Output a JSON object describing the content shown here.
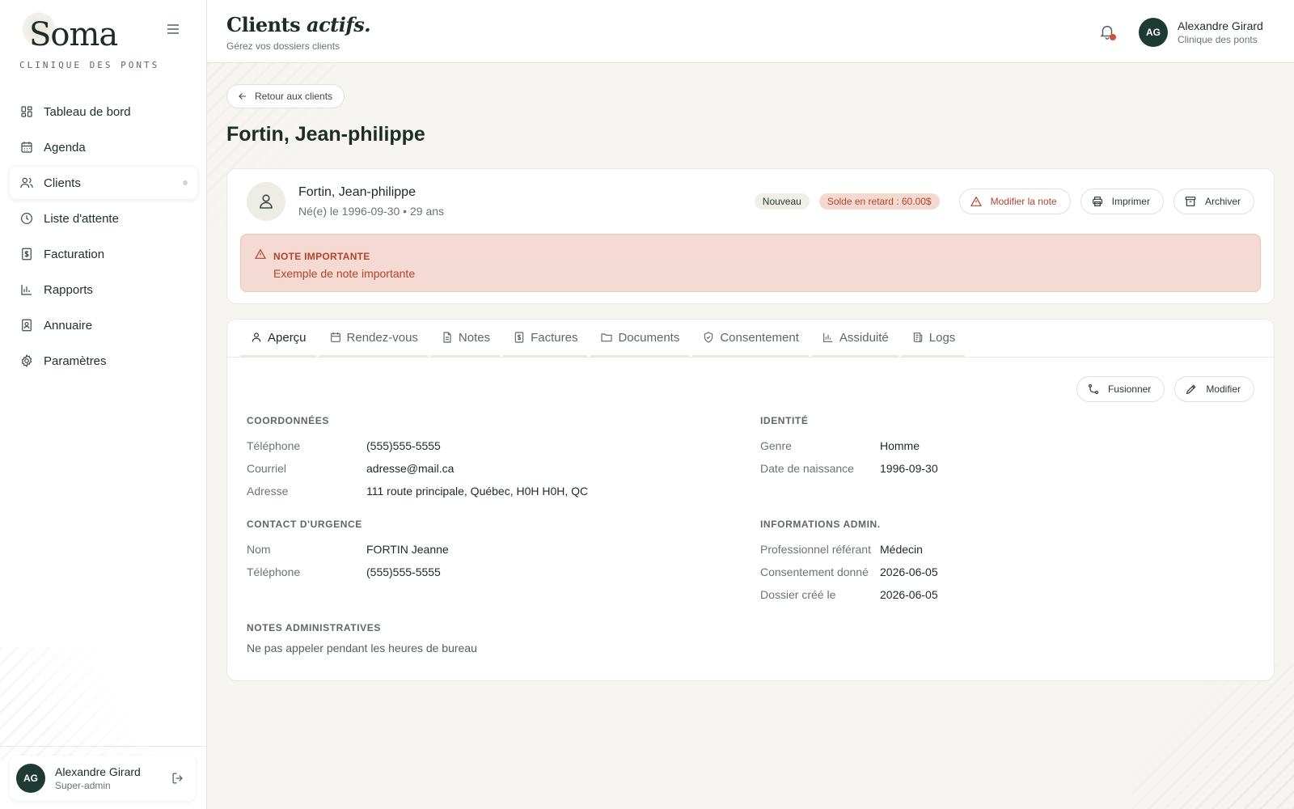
{
  "brand": {
    "name": "Soma",
    "subtitle": "CLINIQUE DES PONTS"
  },
  "nav": [
    {
      "label": "Tableau de bord",
      "icon": "dashboard-icon"
    },
    {
      "label": "Agenda",
      "icon": "calendar-icon"
    },
    {
      "label": "Clients",
      "icon": "users-icon",
      "active": true
    },
    {
      "label": "Liste d'attente",
      "icon": "clock-icon"
    },
    {
      "label": "Facturation",
      "icon": "invoice-icon"
    },
    {
      "label": "Rapports",
      "icon": "bar-chart-icon"
    },
    {
      "label": "Annuaire",
      "icon": "contact-book-icon"
    },
    {
      "label": "Paramètres",
      "icon": "gear-icon"
    }
  ],
  "sidebar_user": {
    "initials": "AG",
    "name": "Alexandre Girard",
    "role": "Super-admin"
  },
  "header": {
    "title": "Clients",
    "title_em": "actifs.",
    "subtitle": "Gérez vos dossiers clients",
    "user": {
      "initials": "AG",
      "name": "Alexandre Girard",
      "clinic": "Clinique des ponts"
    }
  },
  "back_label": "Retour aux clients",
  "client": {
    "heading": "Fortin, Jean-philippe",
    "name": "Fortin, Jean-philippe",
    "dob_line": "Né(e) le 1996-09-30 • 29 ans",
    "badge_new": "Nouveau",
    "badge_late": "Solde en retard : 60.00$",
    "actions": {
      "edit_note": "Modifier la note",
      "print": "Imprimer",
      "archive": "Archiver"
    },
    "important_note": {
      "title": "NOTE IMPORTANTE",
      "body": "Exemple de note importante"
    }
  },
  "tabs": [
    {
      "label": "Aperçu",
      "icon": "user-icon",
      "active": true
    },
    {
      "label": "Rendez-vous",
      "icon": "calendar-icon"
    },
    {
      "label": "Notes",
      "icon": "document-icon"
    },
    {
      "label": "Factures",
      "icon": "invoice-icon"
    },
    {
      "label": "Documents",
      "icon": "folder-icon"
    },
    {
      "label": "Consentement",
      "icon": "shield-check-icon"
    },
    {
      "label": "Assiduité",
      "icon": "bar-chart-icon"
    },
    {
      "label": "Logs",
      "icon": "log-scroll-icon"
    }
  ],
  "body_actions": {
    "merge": "Fusionner",
    "edit": "Modifier"
  },
  "coordonnees": {
    "title": "COORDONNÉES",
    "rows": [
      {
        "k": "Téléphone",
        "v": "(555)555-5555"
      },
      {
        "k": "Courriel",
        "v": "adresse@mail.ca"
      },
      {
        "k": "Adresse",
        "v": "111 route principale, Québec, H0H H0H, QC"
      }
    ]
  },
  "identite": {
    "title": "IDENTITÉ",
    "rows": [
      {
        "k": "Genre",
        "v": "Homme"
      },
      {
        "k": "Date de naissance",
        "v": "1996-09-30"
      }
    ]
  },
  "urgence": {
    "title": "CONTACT D'URGENCE",
    "rows": [
      {
        "k": "Nom",
        "v": "FORTIN Jeanne"
      },
      {
        "k": "Téléphone",
        "v": "(555)555-5555"
      }
    ]
  },
  "admin": {
    "title": "INFORMATIONS ADMIN.",
    "rows": [
      {
        "k": "Professionnel référant",
        "v": "Médecin"
      },
      {
        "k": "Consentement donné",
        "v": "2026-06-05"
      },
      {
        "k": "Dossier créé le",
        "v": "2026-06-05"
      }
    ]
  },
  "notes_admin": {
    "title": "NOTES ADMINISTRATIVES",
    "body": "Ne pas appeler pendant les heures de bureau"
  },
  "colors": {
    "brand_dark": "#1e3a32",
    "danger": "#b2442e",
    "danger_bg": "#f5d9d3"
  }
}
